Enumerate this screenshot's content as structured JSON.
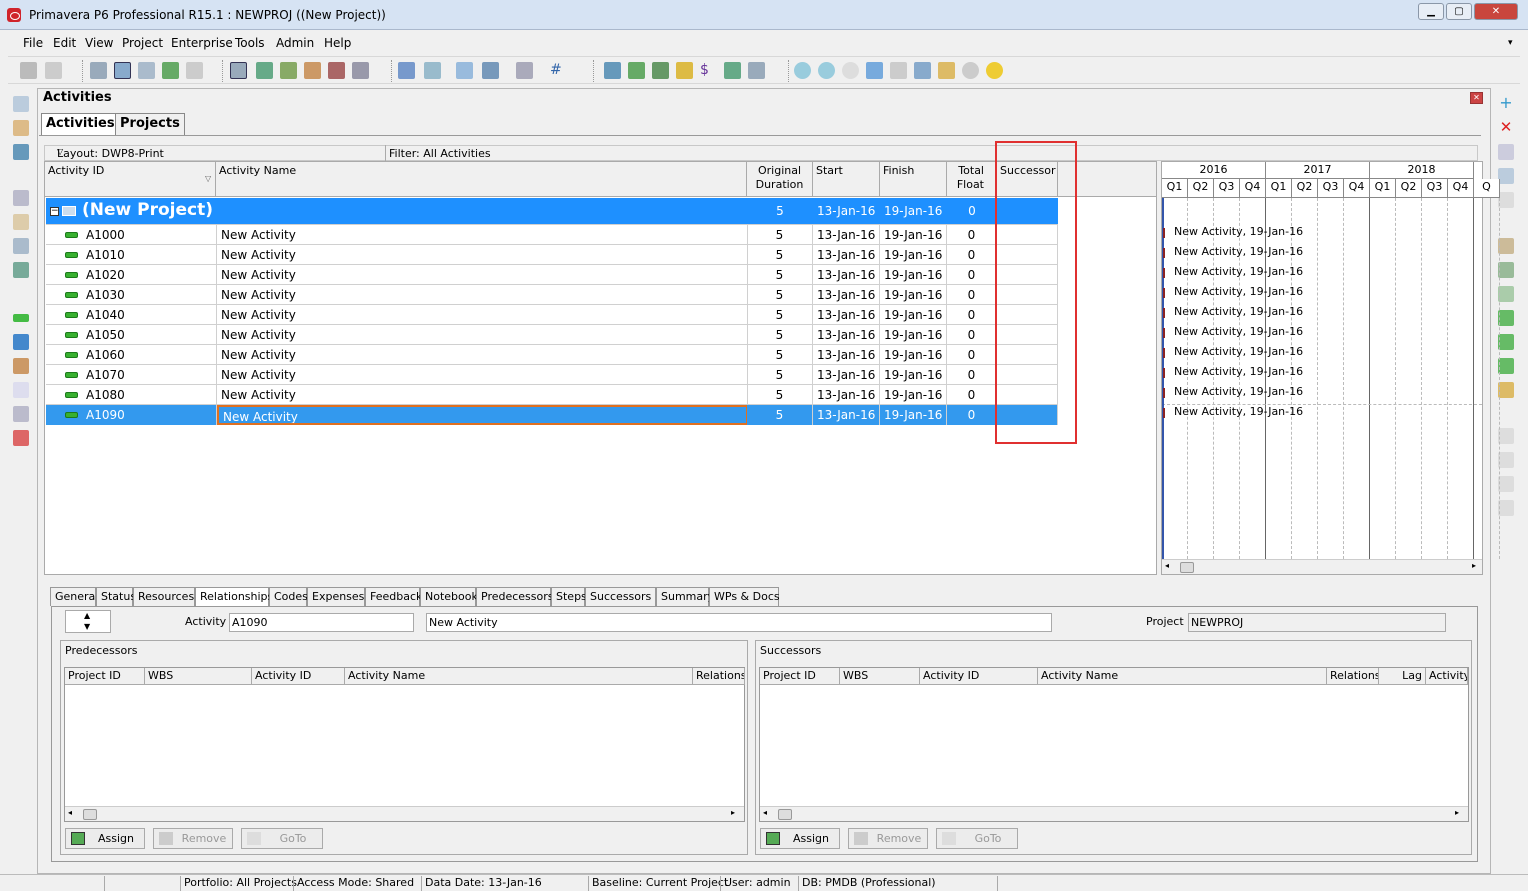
{
  "window": {
    "title": "Primavera P6 Professional R15.1 : NEWPROJ ((New Project))"
  },
  "menu": [
    "File",
    "Edit",
    "View",
    "Project",
    "Enterprise",
    "Tools",
    "Admin",
    "Help"
  ],
  "panel": {
    "title": "Activities",
    "tabs": [
      "Activities",
      "Projects"
    ]
  },
  "layout_bar": {
    "layout": "Layout: DWP8-Print",
    "filter": "Filter: All Activities"
  },
  "grid": {
    "columns": {
      "id": "Activity ID",
      "name": "Activity Name",
      "dur1": "Original",
      "dur2": "Duration",
      "start": "Start",
      "finish": "Finish",
      "float1": "Total",
      "float2": "Float",
      "succ": "Successor"
    },
    "group": {
      "name": "(New Project)",
      "dur": "5",
      "start": "13-Jan-16",
      "finish": "19-Jan-16",
      "float": "0"
    },
    "rows": [
      {
        "id": "A1000",
        "name": "New Activity",
        "dur": "5",
        "start": "13-Jan-16",
        "finish": "19-Jan-16",
        "float": "0"
      },
      {
        "id": "A1010",
        "name": "New Activity",
        "dur": "5",
        "start": "13-Jan-16",
        "finish": "19-Jan-16",
        "float": "0"
      },
      {
        "id": "A1020",
        "name": "New Activity",
        "dur": "5",
        "start": "13-Jan-16",
        "finish": "19-Jan-16",
        "float": "0"
      },
      {
        "id": "A1030",
        "name": "New Activity",
        "dur": "5",
        "start": "13-Jan-16",
        "finish": "19-Jan-16",
        "float": "0"
      },
      {
        "id": "A1040",
        "name": "New Activity",
        "dur": "5",
        "start": "13-Jan-16",
        "finish": "19-Jan-16",
        "float": "0"
      },
      {
        "id": "A1050",
        "name": "New Activity",
        "dur": "5",
        "start": "13-Jan-16",
        "finish": "19-Jan-16",
        "float": "0"
      },
      {
        "id": "A1060",
        "name": "New Activity",
        "dur": "5",
        "start": "13-Jan-16",
        "finish": "19-Jan-16",
        "float": "0"
      },
      {
        "id": "A1070",
        "name": "New Activity",
        "dur": "5",
        "start": "13-Jan-16",
        "finish": "19-Jan-16",
        "float": "0"
      },
      {
        "id": "A1080",
        "name": "New Activity",
        "dur": "5",
        "start": "13-Jan-16",
        "finish": "19-Jan-16",
        "float": "0"
      },
      {
        "id": "A1090",
        "name": "New Activity",
        "dur": "5",
        "start": "13-Jan-16",
        "finish": "19-Jan-16",
        "float": "0"
      }
    ]
  },
  "gantt": {
    "years": [
      "2016",
      "2017",
      "2018"
    ],
    "quarters": [
      "Q1",
      "Q2",
      "Q3",
      "Q4",
      "Q1",
      "Q2",
      "Q3",
      "Q4",
      "Q1",
      "Q2",
      "Q3",
      "Q4",
      "Q"
    ],
    "bar_label": "New Activity, 19-Jan-16"
  },
  "bottom_tabs": [
    "General",
    "Status",
    "Resources",
    "Relationships",
    "Codes",
    "Expenses",
    "Feedback",
    "Notebook",
    "Predecessors",
    "Steps",
    "Successors",
    "Summary",
    "WPs & Docs"
  ],
  "detail": {
    "activity_label": "Activity",
    "activity_id": "A1090",
    "activity_name": "New Activity",
    "project_label": "Project",
    "project": "NEWPROJ",
    "pred_title": "Predecessors",
    "succ_title": "Successors",
    "pred_cols": [
      "Project ID",
      "WBS",
      "Activity ID",
      "Activity Name",
      "Relations"
    ],
    "succ_cols": [
      "Project ID",
      "WBS",
      "Activity ID",
      "Activity Name",
      "Relations",
      "Lag",
      "Activity"
    ],
    "buttons": {
      "assign": "Assign",
      "remove": "Remove",
      "goto": "GoTo"
    }
  },
  "status": [
    "Portfolio: All Projects",
    "Access Mode: Shared",
    "Data Date: 13-Jan-16",
    "Baseline: Current Project",
    "User: admin",
    "DB: PMDB (Professional)"
  ],
  "colors": {
    "selection": "#3399ee",
    "group": "#1e90ff",
    "highlight": "#e03030",
    "bar": "#38b030"
  }
}
